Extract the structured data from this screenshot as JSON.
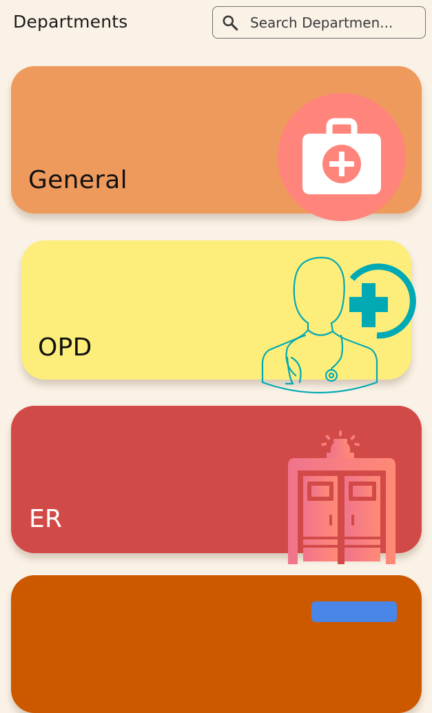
{
  "header": {
    "title": "Departments",
    "search": {
      "placeholder": "Search Departmen..."
    }
  },
  "departments": [
    {
      "label": "General",
      "icon": "first-aid-kit-icon",
      "color": "#EE9A5C"
    },
    {
      "label": "OPD",
      "icon": "doctor-with-plus-icon",
      "color": "#FDEE7B"
    },
    {
      "label": "ER",
      "icon": "emergency-room-doors-icon",
      "color": "#D24A47"
    },
    {
      "label": "",
      "icon": "partial-card",
      "color": "#CC5800"
    }
  ],
  "colors": {
    "background": "#FAF2E6",
    "general_badge": "#FF847C",
    "opd_accent": "#00A9B4",
    "er_door": "#F47A8A"
  }
}
